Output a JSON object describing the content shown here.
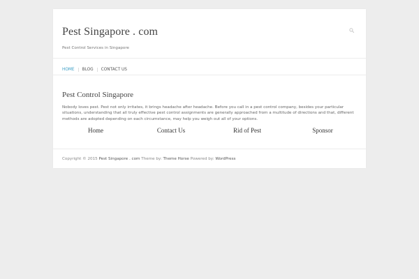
{
  "site": {
    "title": "Pest Singapore . com",
    "description": "Pest Control Services in Singapore"
  },
  "header": {
    "search_icon": "search-icon"
  },
  "nav": {
    "items": [
      {
        "label": "HOME",
        "active": true
      },
      {
        "label": "BLOG",
        "active": false
      },
      {
        "label": "CONTACT US",
        "active": false
      }
    ],
    "active_color": "#3a9dc4"
  },
  "main": {
    "title": "Pest Control Singapore",
    "body": "Nobody loves pest. Pest not only irritates, it brings headache after headache. Before you call in a pest control company, besides your particular situations, understanding that all truly effective pest control assignments are generally approached from a multitude of directions and that, different methods are adopted depending on each circumstance, may help you weigh out all of your options.",
    "links": [
      "Home",
      "Contact Us",
      "Rid of Pest",
      "Sponsor"
    ]
  },
  "footer": {
    "copyright": "Copyright © 2015",
    "site_link": "Pest Singapore . com",
    "theme_by": "Theme by:",
    "theme_link": "Theme Horse",
    "powered_by": "Powered by:",
    "wp_link": "WordPress"
  }
}
